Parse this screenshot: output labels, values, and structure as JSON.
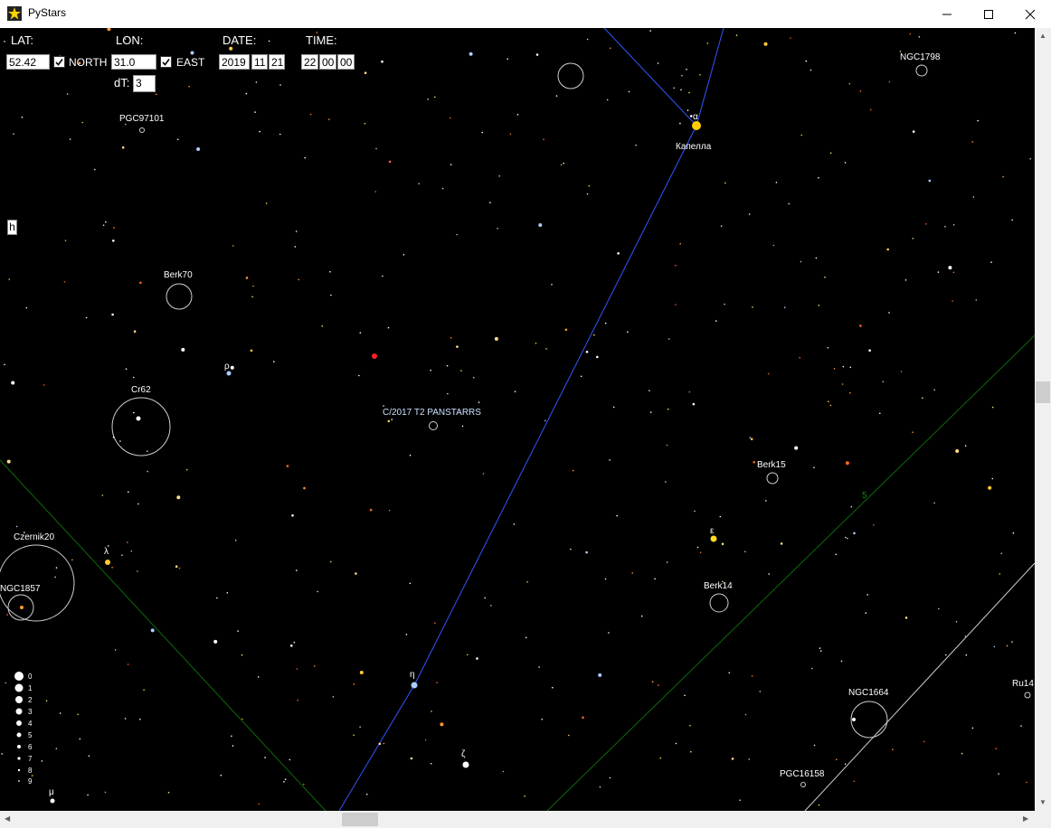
{
  "window": {
    "title": "PyStars",
    "minimize_glyph": "—",
    "maximize_glyph": "☐",
    "close_glyph": "✕"
  },
  "controls": {
    "lat_label": "LAT:",
    "lon_label": "LON:",
    "date_label": "DATE:",
    "time_label": "TIME:",
    "lat_value": "52.42",
    "north_label": "NORTH",
    "north_checked": true,
    "lon_value": "31.0",
    "east_label": "EAST",
    "east_checked": true,
    "year": "2019",
    "month": "11",
    "day": "21",
    "hour": "22",
    "minute": "00",
    "second": "00",
    "dt_label": "dT:",
    "dt_value": "3",
    "h_button": "h"
  },
  "labels": {
    "pgc97101": "PGC97101",
    "ngc1798": "NGC1798",
    "alpha": "α",
    "capella": "Капелла",
    "berk70": "Berk70",
    "rho": "ρ",
    "cr62": "Cr62",
    "comet": "C/2017 T2 PANSTARRS",
    "berk15": "Berk15",
    "grid5": "5",
    "epsilon": "ε",
    "czernik20": "Czernik20",
    "lambda": "λ",
    "ngc1857": "NGC1857",
    "berk14": "Berk14",
    "eta": "η",
    "zeta": "ζ",
    "ngc1664": "NGC1664",
    "ru14": "Ru14",
    "pgc16158": "PGC16158",
    "mu": "μ"
  },
  "magnitude_legend": [
    "0",
    "1",
    "2",
    "3",
    "4",
    "5",
    "6",
    "7",
    "8",
    "9"
  ],
  "colors": {
    "sky": "#000000",
    "constellation_line": "#3355ff",
    "grid_green": "#0a6b0a",
    "grid_white": "#d0d0d0",
    "star_white": "#ffffff",
    "star_yellow": "#ffdd22",
    "star_orange": "#ff9933",
    "star_blue": "#aaccff",
    "comet_label": "#cce0ff",
    "highlight_red": "#ff2222"
  }
}
